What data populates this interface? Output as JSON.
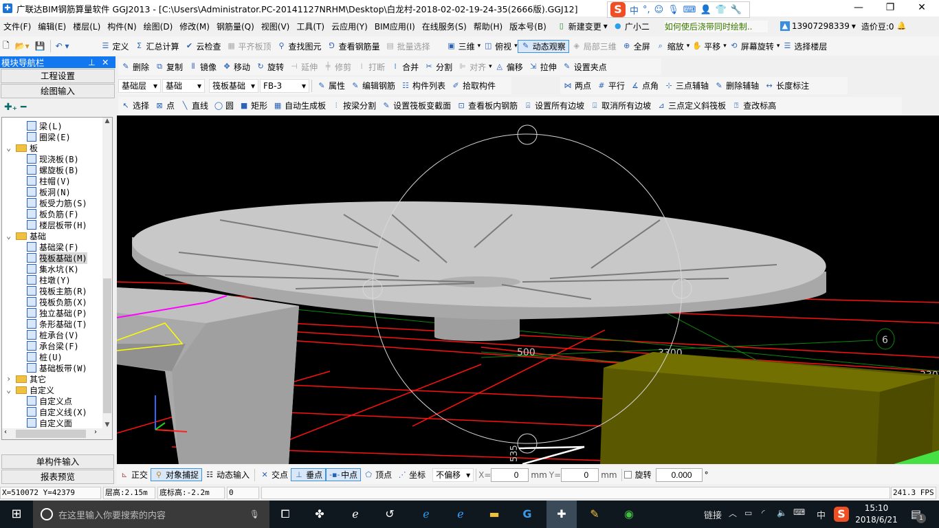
{
  "title": "广联达BIM钢筋算量软件 GGJ2013 - [C:\\Users\\Administrator.PC-20141127NRHM\\Desktop\\白龙村-2018-02-02-19-24-35(2666版).GGJ12]",
  "ime": {
    "lang": "中",
    "punct": "°,"
  },
  "menu": [
    "文件(F)",
    "编辑(E)",
    "楼层(L)",
    "构件(N)",
    "绘图(D)",
    "修改(M)",
    "钢筋量(Q)",
    "视图(V)",
    "工具(T)",
    "云应用(Y)",
    "BIM应用(I)",
    "在线服务(S)",
    "帮助(H)",
    "版本号(B)"
  ],
  "menu_extra": {
    "new_change": "新建变更",
    "assistant": "广小二",
    "tip": "如何使后浇带同时绘制..",
    "phone": "13907298339",
    "beans": "造价豆:0"
  },
  "toolbar1": [
    {
      "label": "定义",
      "dis": false
    },
    {
      "label": "汇总计算",
      "dis": false
    },
    {
      "label": "云检查",
      "dis": false
    },
    {
      "label": "平齐板顶",
      "dis": true
    },
    {
      "label": "查找图元",
      "dis": false
    },
    {
      "label": "查看钢筋量",
      "dis": false
    },
    {
      "label": "批量选择",
      "dis": true
    }
  ],
  "toolbar1_right": [
    {
      "label": "三维",
      "dis": false
    },
    {
      "label": "俯视",
      "dis": false
    },
    {
      "label": "动态观察",
      "dis": false,
      "pressed": true
    },
    {
      "label": "局部三维",
      "dis": true
    },
    {
      "label": "全屏",
      "dis": false
    },
    {
      "label": "缩放",
      "dis": false
    },
    {
      "label": "平移",
      "dis": false
    },
    {
      "label": "屏幕旋转",
      "dis": false
    },
    {
      "label": "选择楼层",
      "dis": false
    }
  ],
  "toolbar2": [
    {
      "label": "删除",
      "dis": false
    },
    {
      "label": "复制",
      "dis": false
    },
    {
      "label": "镜像",
      "dis": false
    },
    {
      "label": "移动",
      "dis": false
    },
    {
      "label": "旋转",
      "dis": false
    },
    {
      "label": "延伸",
      "dis": true
    },
    {
      "label": "修剪",
      "dis": true
    },
    {
      "label": "打断",
      "dis": true
    },
    {
      "label": "合并",
      "dis": false
    },
    {
      "label": "分割",
      "dis": false
    },
    {
      "label": "对齐",
      "dis": true
    },
    {
      "label": "偏移",
      "dis": false
    },
    {
      "label": "拉伸",
      "dis": false
    },
    {
      "label": "设置夹点",
      "dis": false
    }
  ],
  "selectors": {
    "floor": "基础层",
    "category": "基础",
    "type": "筏板基础",
    "item": "FB-3"
  },
  "toolbar3": [
    "属性",
    "编辑钢筋",
    "构件列表",
    "拾取构件"
  ],
  "toolbar3_right": [
    "两点",
    "平行",
    "点角",
    "三点辅轴",
    "删除辅轴",
    "长度标注"
  ],
  "toolbar4": [
    "选择",
    "点",
    "直线",
    "圆",
    "矩形",
    "自动生成板",
    "按梁分割",
    "设置筏板变截面",
    "查看板内钢筋",
    "设置所有边坡",
    "取消所有边坡",
    "三点定义斜筏板",
    "查改标高"
  ],
  "nav": {
    "title": "模块导航栏",
    "project_settings": "工程设置",
    "drawing_input": "绘图输入",
    "single_input": "单构件输入",
    "report_preview": "报表预览",
    "tree": [
      {
        "label": "梁(L)",
        "level": 2
      },
      {
        "label": "圈梁(E)",
        "level": 2
      },
      {
        "label": "板",
        "level": 1,
        "open": true
      },
      {
        "label": "现浇板(B)",
        "level": 2
      },
      {
        "label": "螺旋板(B)",
        "level": 2
      },
      {
        "label": "柱帽(V)",
        "level": 2
      },
      {
        "label": "板洞(N)",
        "level": 2
      },
      {
        "label": "板受力筋(S)",
        "level": 2
      },
      {
        "label": "板负筋(F)",
        "level": 2
      },
      {
        "label": "楼层板带(H)",
        "level": 2
      },
      {
        "label": "基础",
        "level": 1,
        "open": true
      },
      {
        "label": "基础梁(F)",
        "level": 2
      },
      {
        "label": "筏板基础(M)",
        "level": 2,
        "selected": true
      },
      {
        "label": "集水坑(K)",
        "level": 2
      },
      {
        "label": "柱墩(Y)",
        "level": 2
      },
      {
        "label": "筏板主筋(R)",
        "level": 2
      },
      {
        "label": "筏板负筋(X)",
        "level": 2
      },
      {
        "label": "独立基础(P)",
        "level": 2
      },
      {
        "label": "条形基础(T)",
        "level": 2
      },
      {
        "label": "桩承台(V)",
        "level": 2
      },
      {
        "label": "承台梁(F)",
        "level": 2
      },
      {
        "label": "桩(U)",
        "level": 2
      },
      {
        "label": "基础板带(W)",
        "level": 2
      },
      {
        "label": "其它",
        "level": 1,
        "open": false
      },
      {
        "label": "自定义",
        "level": 1,
        "open": true
      },
      {
        "label": "自定义点",
        "level": 2
      },
      {
        "label": "自定义线(X)",
        "level": 2
      },
      {
        "label": "自定义面",
        "level": 2
      },
      {
        "label": "尺寸标注(W)",
        "level": 2
      }
    ]
  },
  "viewport": {
    "labels": {
      "dim1": "500",
      "dim2": "3300",
      "dim3": "330",
      "axis": "6",
      "dim4": "535"
    }
  },
  "snapbar": {
    "ortho": "正交",
    "snap": "对象捕捉",
    "dyn": "动态输入",
    "intersect": "交点",
    "perp": "垂点",
    "mid": "中点",
    "vertex": "顶点",
    "coord": "坐标",
    "offset": "不偏移",
    "x_label": "X=",
    "x": "0",
    "mm1": "mm",
    "y_label": "Y=",
    "y": "0",
    "mm2": "mm",
    "rotate": "旋转",
    "angle": "0.000",
    "deg": "°"
  },
  "status": {
    "coords": "X=510072 Y=42379",
    "floor_height": "层高:2.15m",
    "bottom_elev": "底标高:-2.2m",
    "val": "0",
    "fps": "241.3 FPS"
  },
  "taskbar": {
    "search": "在这里输入你要搜索的内容",
    "link": "链接",
    "ime": "中",
    "time": "15:10",
    "date": "2018/6/21",
    "notif": "1"
  }
}
